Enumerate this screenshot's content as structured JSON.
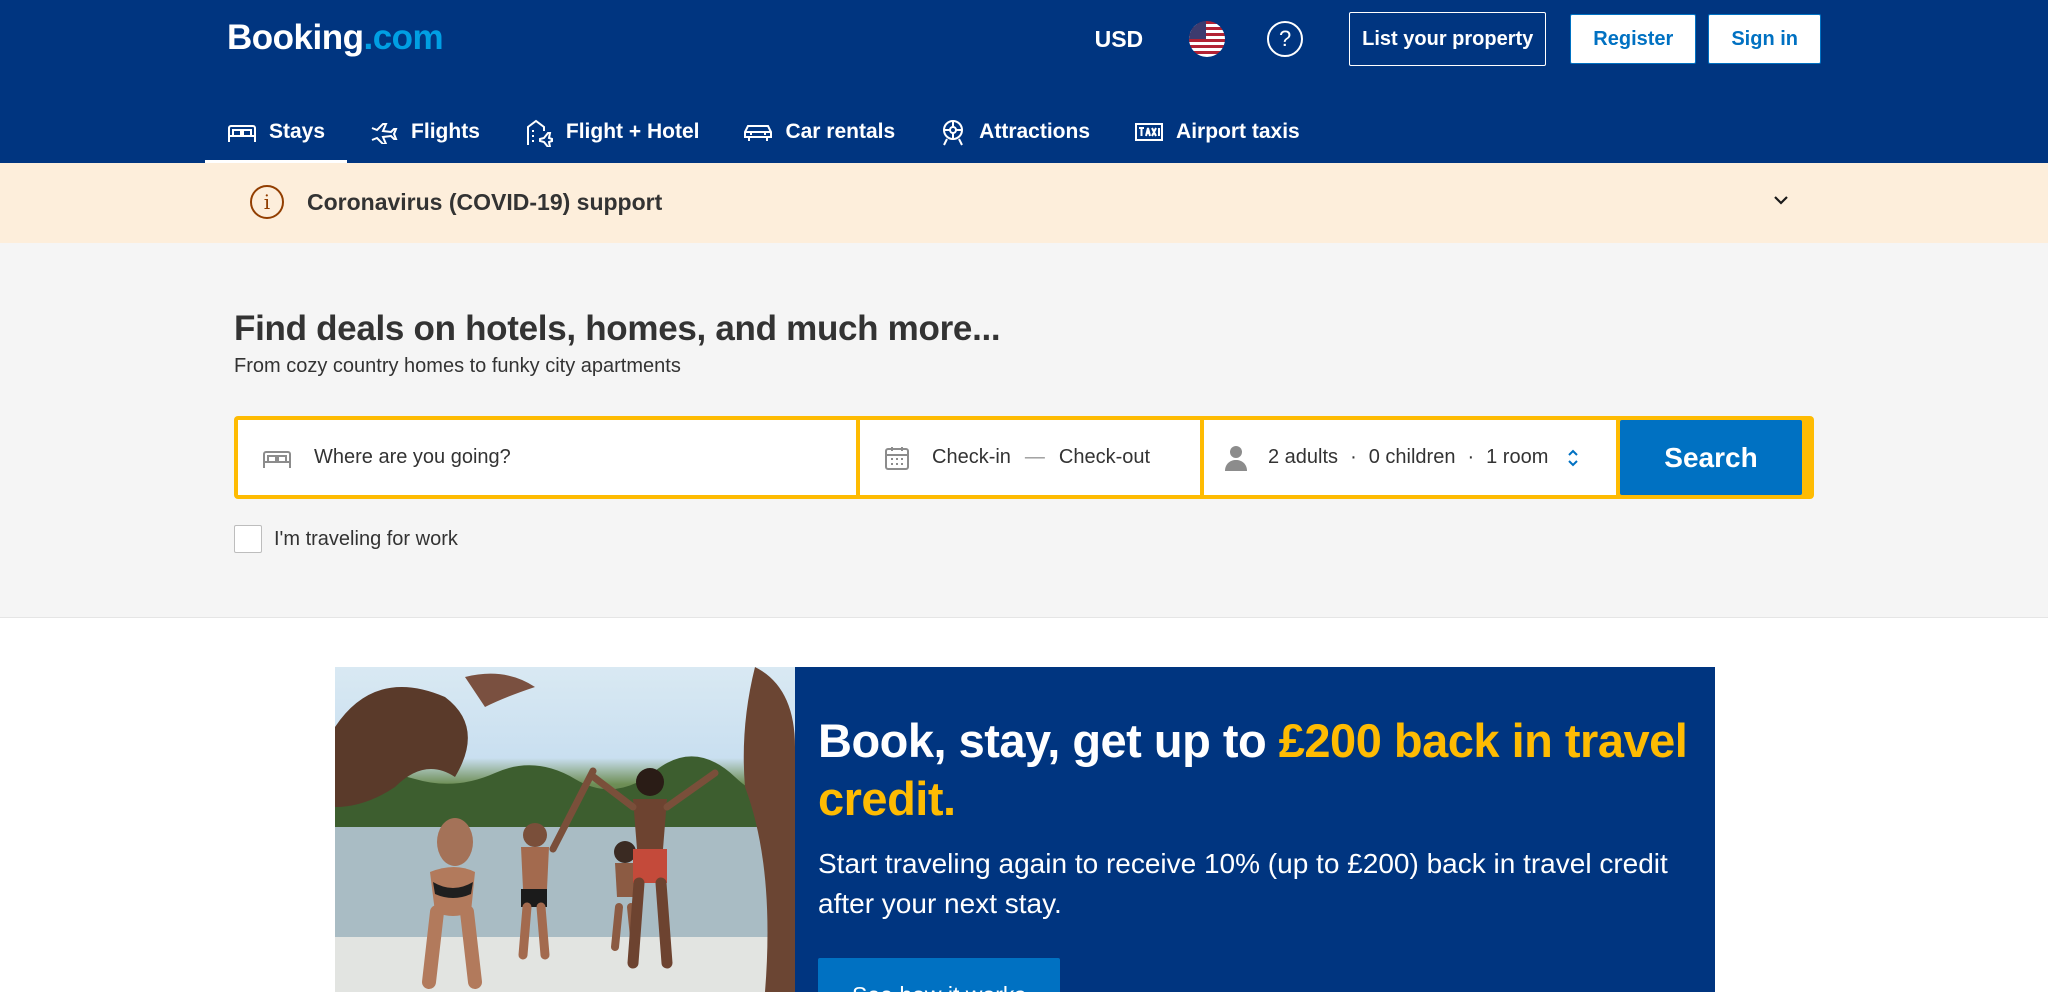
{
  "header": {
    "logo_part1": "Booking",
    "logo_part2": ".com",
    "currency": "USD",
    "flag_icon": "us-flag-icon",
    "help_icon": "question-circle-icon",
    "list_property_label": "List your property",
    "register_label": "Register",
    "sign_in_label": "Sign in"
  },
  "nav": {
    "items": [
      {
        "label": "Stays",
        "icon": "bed-icon",
        "active": true
      },
      {
        "label": "Flights",
        "icon": "plane-icon"
      },
      {
        "label": "Flight + Hotel",
        "icon": "flight-hotel-icon"
      },
      {
        "label": "Car rentals",
        "icon": "car-icon"
      },
      {
        "label": "Attractions",
        "icon": "attractions-icon"
      },
      {
        "label": "Airport taxis",
        "icon": "taxi-icon"
      }
    ]
  },
  "covid": {
    "text": "Coronavirus (COVID-19) support",
    "icon": "info-icon"
  },
  "search": {
    "title": "Find deals on hotels, homes, and much more...",
    "subtitle": "From cozy country homes to funky city apartments",
    "destination_placeholder": "Where are you going?",
    "checkin": "Check-in",
    "dash": "—",
    "checkout": "Check-out",
    "adults": "2 adults",
    "children": "0 children",
    "rooms": "1 room",
    "dot": "·",
    "button_label": "Search",
    "work_label": "I'm traveling for work"
  },
  "promo": {
    "title_white": "Book, stay, get up to ",
    "title_highlight": "£200 back in travel credit.",
    "text": "Start traveling again to receive 10% (up to £200) back in travel credit after your next stay.",
    "button_label": "See how it works"
  },
  "colors": {
    "brand_dark_blue": "#003580",
    "brand_light_blue": "#009fe3",
    "button_blue": "#0071c2",
    "accent_yellow": "#febb02",
    "covid_band": "#fdeedb"
  }
}
